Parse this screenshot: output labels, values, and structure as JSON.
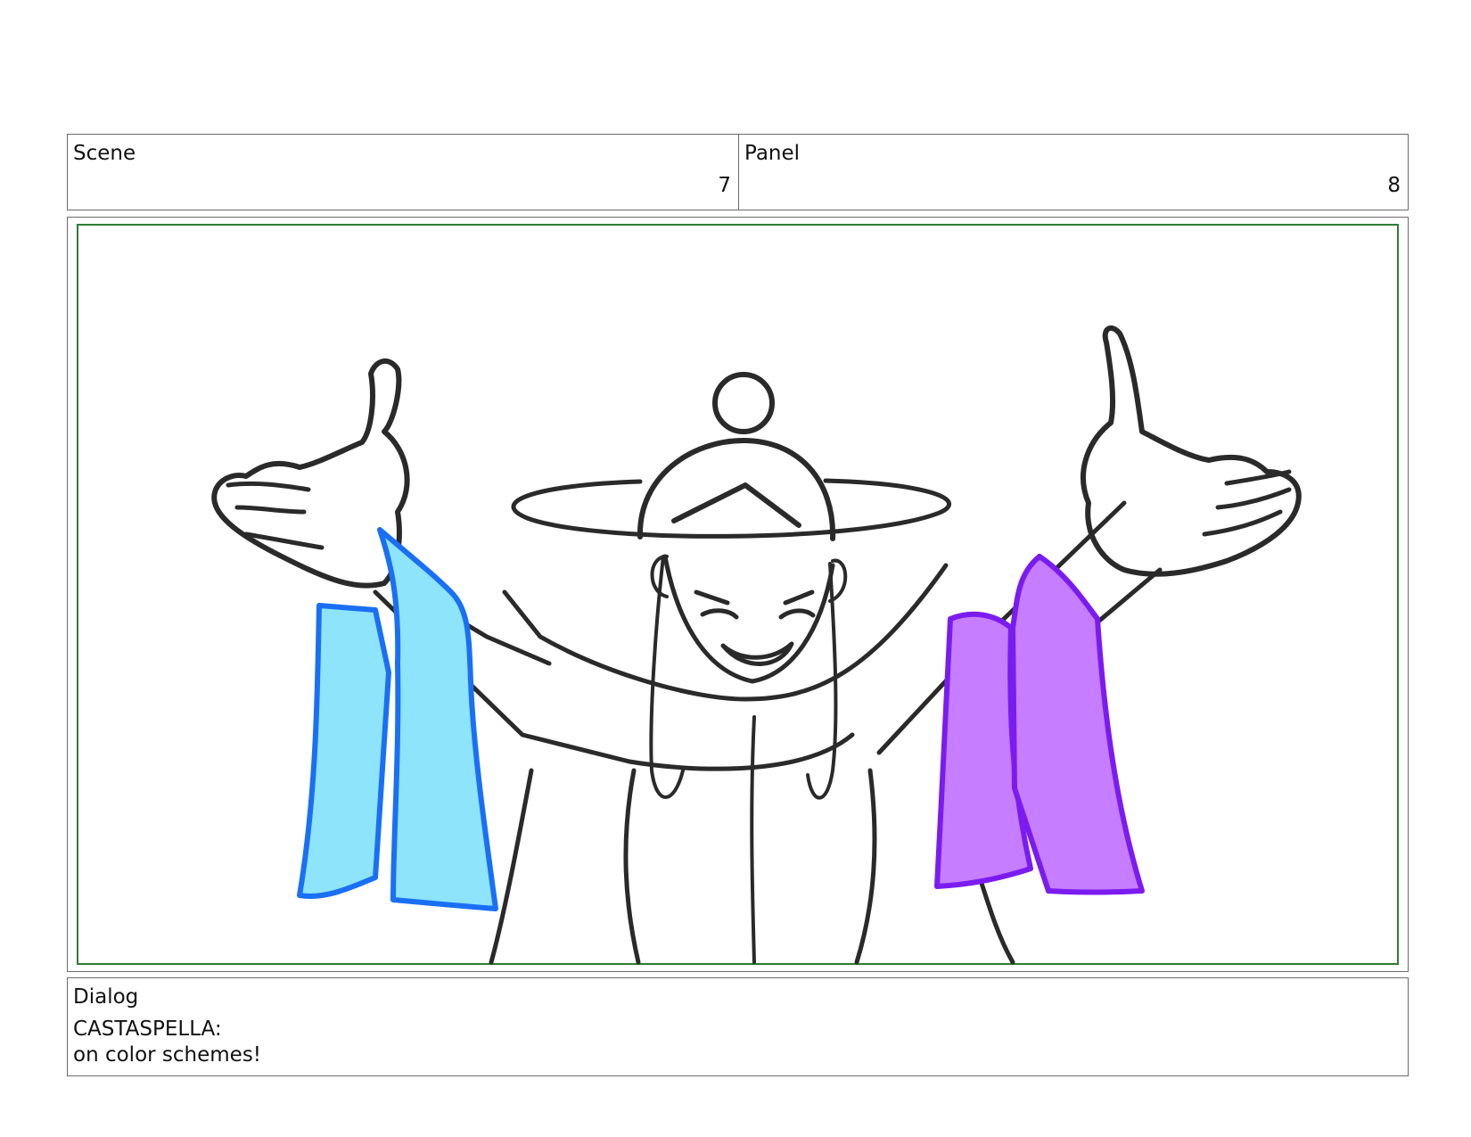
{
  "header": {
    "scene_label": "Scene",
    "scene_number": "7",
    "panel_label": "Panel",
    "panel_number": "8"
  },
  "artwork": {
    "subject_icon": "character-sketch",
    "colors": {
      "frame_border": "#2e7d32",
      "ink": "#2a2a2a",
      "left_scarf_fill": "#8de4fb",
      "left_scarf_line": "#1a6ff5",
      "right_scarf_fill": "#c77dff",
      "right_scarf_line": "#7a1cf0"
    }
  },
  "dialog": {
    "label": "Dialog",
    "speaker": "CASTASPELLA:",
    "line": "on color schemes!"
  }
}
